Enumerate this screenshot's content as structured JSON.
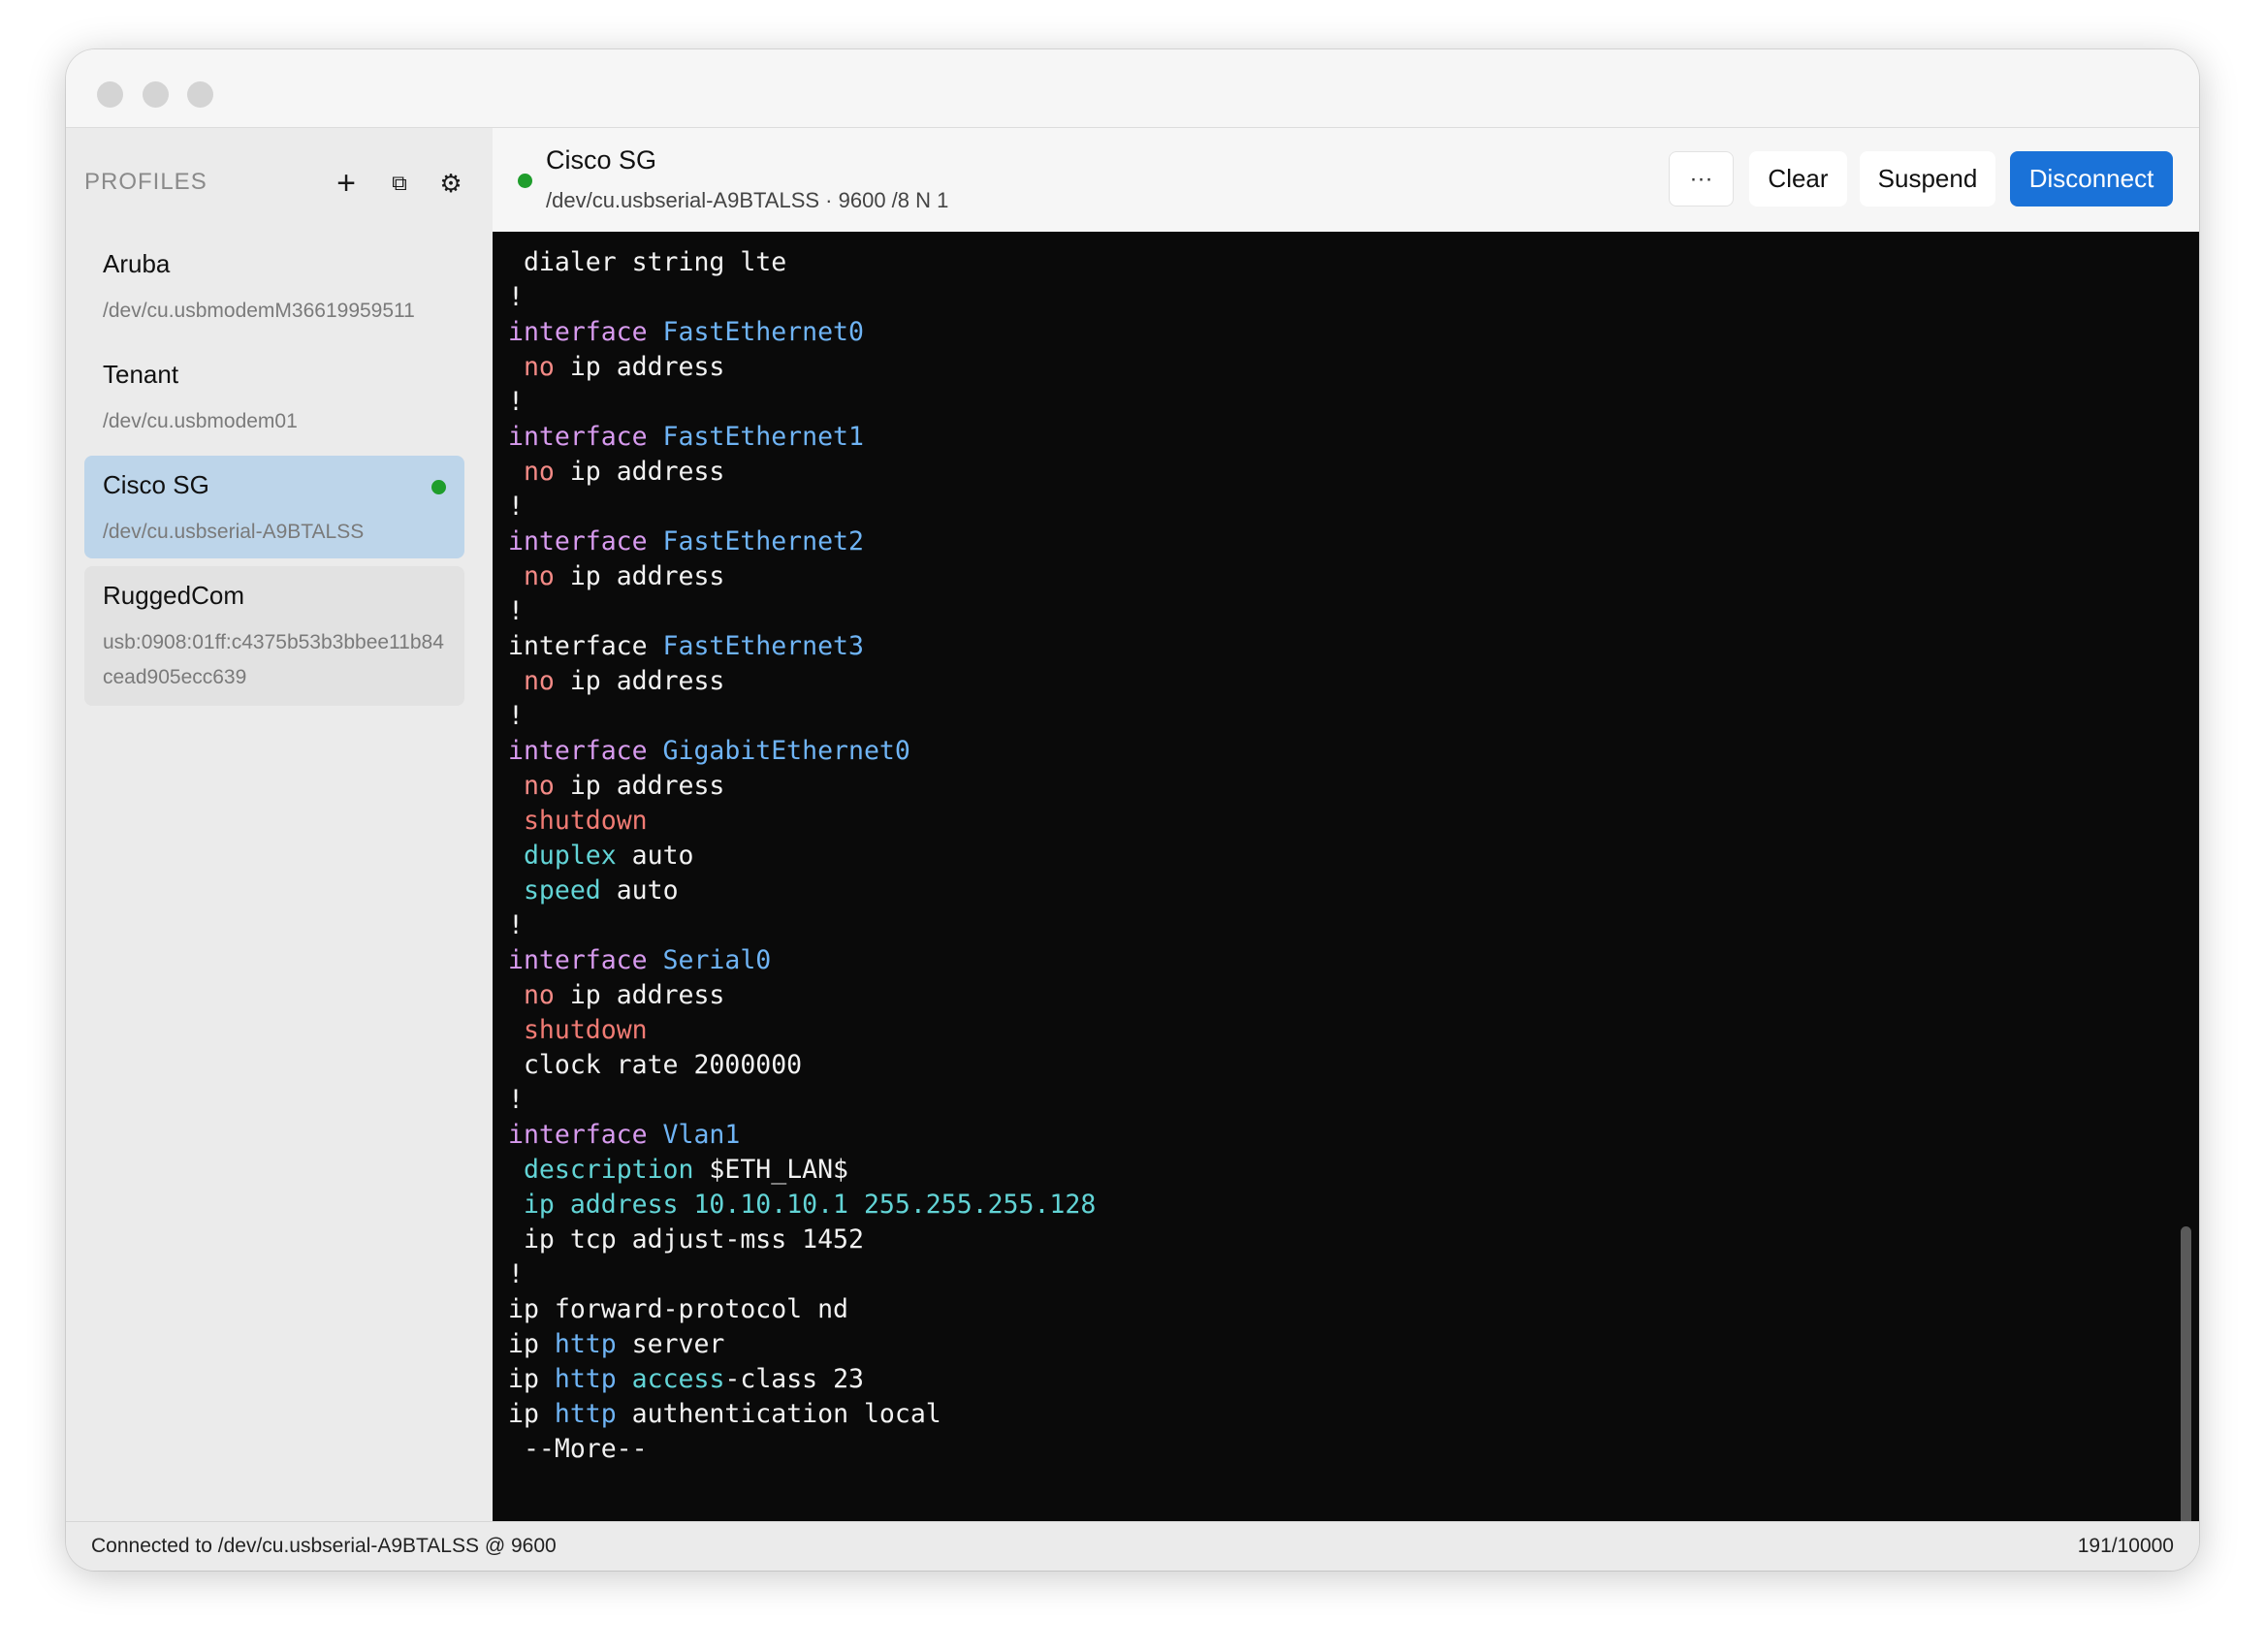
{
  "sidebar": {
    "title": "PROFILES",
    "icons": {
      "add": "+",
      "duplicate": "⧉",
      "settings": "⚙"
    },
    "profiles": [
      {
        "name": "Aruba",
        "path": "/dev/cu.usbmodemM36619959511"
      },
      {
        "name": "Tenant",
        "path": "/dev/cu.usbmodem01"
      },
      {
        "name": "Cisco SG",
        "path": "/dev/cu.usbserial-A9BTALSS",
        "status": "connected"
      },
      {
        "name": "RuggedCom",
        "path": "usb:0908:01ff:c4375b53b3bbee11b84cead905ecc639"
      }
    ]
  },
  "header": {
    "title": "Cisco SG",
    "subtitle": "/dev/cu.usbserial-A9BTALSS · 9600 /8 N 1",
    "more_label": "···",
    "clear_label": "Clear",
    "suspend_label": "Suspend",
    "disconnect_label": "Disconnect"
  },
  "terminal": {
    "lines": [
      [
        [
          "t",
          " dialer string lte"
        ]
      ],
      [
        [
          "t",
          "!"
        ]
      ],
      [
        [
          "kw",
          "interface "
        ],
        [
          "if",
          "FastEthernet0"
        ]
      ],
      [
        [
          "t",
          " "
        ],
        [
          "no",
          "no"
        ],
        [
          "t",
          " ip address"
        ]
      ],
      [
        [
          "t",
          "!"
        ]
      ],
      [
        [
          "kw",
          "interface "
        ],
        [
          "if",
          "FastEthernet1"
        ]
      ],
      [
        [
          "t",
          " "
        ],
        [
          "no",
          "no"
        ],
        [
          "t",
          " ip address"
        ]
      ],
      [
        [
          "t",
          "!"
        ]
      ],
      [
        [
          "kw",
          "interface "
        ],
        [
          "if",
          "FastEthernet2"
        ]
      ],
      [
        [
          "t",
          " "
        ],
        [
          "no",
          "no"
        ],
        [
          "t",
          " ip address"
        ]
      ],
      [
        [
          "t",
          "!"
        ]
      ],
      [
        [
          "t",
          "interface "
        ],
        [
          "if",
          "FastEthernet3"
        ]
      ],
      [
        [
          "t",
          " "
        ],
        [
          "no",
          "no"
        ],
        [
          "t",
          " ip address"
        ]
      ],
      [
        [
          "t",
          "!"
        ]
      ],
      [
        [
          "kw",
          "interface "
        ],
        [
          "if",
          "GigabitEthernet0"
        ]
      ],
      [
        [
          "t",
          " "
        ],
        [
          "no",
          "no"
        ],
        [
          "t",
          " ip address"
        ]
      ],
      [
        [
          "t",
          " "
        ],
        [
          "sh",
          "shutdown"
        ]
      ],
      [
        [
          "t",
          " "
        ],
        [
          "cy",
          "duplex"
        ],
        [
          "t",
          " auto"
        ]
      ],
      [
        [
          "t",
          " "
        ],
        [
          "cy",
          "speed"
        ],
        [
          "t",
          " auto"
        ]
      ],
      [
        [
          "t",
          "!"
        ]
      ],
      [
        [
          "kw",
          "interface "
        ],
        [
          "if",
          "Serial0"
        ]
      ],
      [
        [
          "t",
          " "
        ],
        [
          "no",
          "no"
        ],
        [
          "t",
          " ip address"
        ]
      ],
      [
        [
          "t",
          " "
        ],
        [
          "sh",
          "shutdown"
        ]
      ],
      [
        [
          "t",
          " clock rate 2000000"
        ]
      ],
      [
        [
          "t",
          "!"
        ]
      ],
      [
        [
          "kw",
          "interface "
        ],
        [
          "if",
          "Vlan1"
        ]
      ],
      [
        [
          "t",
          " "
        ],
        [
          "cy",
          "description"
        ],
        [
          "t",
          " $ETH_LAN$"
        ]
      ],
      [
        [
          "t",
          " "
        ],
        [
          "cy",
          "ip address 10.10.10.1 255.255.255.128"
        ]
      ],
      [
        [
          "t",
          " ip tcp adjust-mss 1452"
        ]
      ],
      [
        [
          "t",
          "!"
        ]
      ],
      [
        [
          "t",
          "ip forward-protocol nd"
        ]
      ],
      [
        [
          "t",
          "ip "
        ],
        [
          "if",
          "http"
        ],
        [
          "t",
          " server"
        ]
      ],
      [
        [
          "t",
          "ip "
        ],
        [
          "if",
          "http"
        ],
        [
          "t",
          " "
        ],
        [
          "cy",
          "access"
        ],
        [
          "t",
          "-class 23"
        ]
      ],
      [
        [
          "t",
          "ip "
        ],
        [
          "if",
          "http"
        ],
        [
          "t",
          " authentication local"
        ]
      ],
      [
        [
          "t",
          " --More--"
        ]
      ]
    ]
  },
  "status": {
    "left": "Connected to /dev/cu.usbserial-A9BTALSS @ 9600",
    "right": "191/10000"
  },
  "colors": {
    "accent": "#1a72d8",
    "connected": "#1f9d2c",
    "selected_profile": "#bdd5ea",
    "terminal_bg": "#0a0a0a",
    "keyword": "#d79aee",
    "interface_name": "#6fb4f5",
    "negation": "#f38a86",
    "shutdown": "#f07b74",
    "parameter": "#62d4d6"
  }
}
